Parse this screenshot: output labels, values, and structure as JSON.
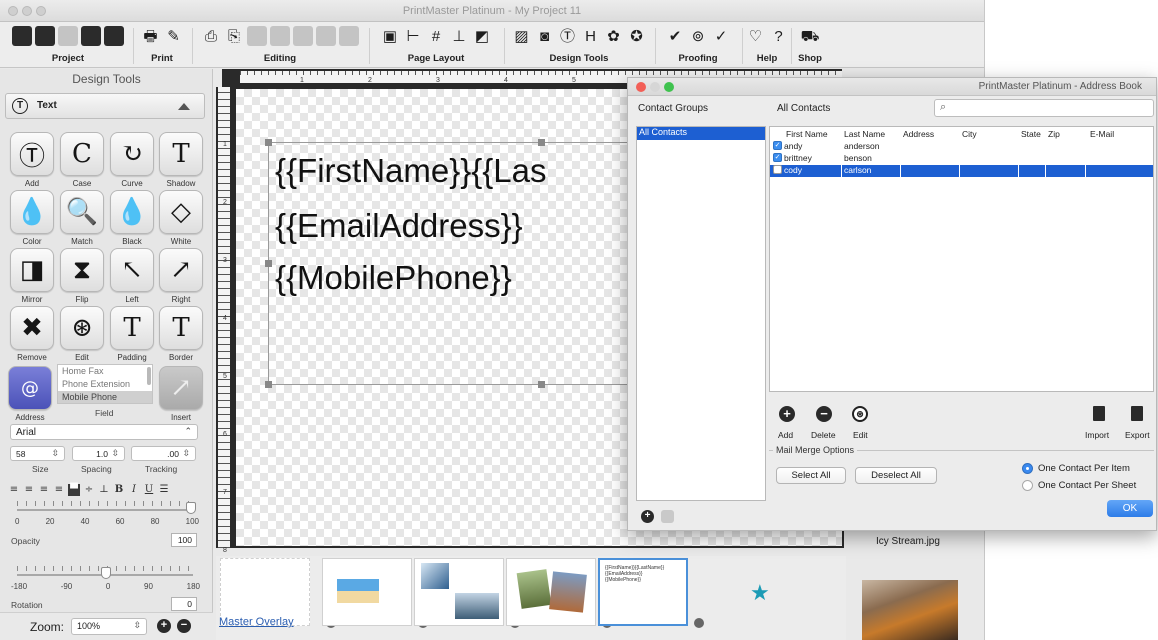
{
  "main_window": {
    "title": "PrintMaster Platinum - My Project 11",
    "toolbar": [
      {
        "label": "Project"
      },
      {
        "label": "Print"
      },
      {
        "label": "Editing"
      },
      {
        "label": "Page Layout"
      },
      {
        "label": "Design Tools"
      },
      {
        "label": "Proofing"
      },
      {
        "label": "Help"
      },
      {
        "label": "Shop"
      }
    ]
  },
  "design_tools": {
    "title": "Design Tools",
    "section": "Text",
    "tools": [
      {
        "label": "Add",
        "glyph": "Ⓣ"
      },
      {
        "label": "Case",
        "glyph": "C"
      },
      {
        "label": "Curve",
        "glyph": "↻"
      },
      {
        "label": "Shadow",
        "glyph": "T"
      },
      {
        "label": "Color",
        "glyph": "💧"
      },
      {
        "label": "Match",
        "glyph": "🔍"
      },
      {
        "label": "Black",
        "glyph": "💧"
      },
      {
        "label": "White",
        "glyph": "◇"
      },
      {
        "label": "Mirror",
        "glyph": "◨"
      },
      {
        "label": "Flip",
        "glyph": "⧗"
      },
      {
        "label": "Left",
        "glyph": "↖"
      },
      {
        "label": "Right",
        "glyph": "↗"
      },
      {
        "label": "Remove",
        "glyph": "✖"
      },
      {
        "label": "Edit",
        "glyph": "⊛"
      },
      {
        "label": "Padding",
        "glyph": "T"
      },
      {
        "label": "Border",
        "glyph": "T"
      }
    ],
    "field_list": [
      "Home Fax",
      "Phone Extension",
      "Mobile Phone"
    ],
    "address_label": "Address",
    "field_label": "Field",
    "insert_label": "Insert",
    "font": "Arial",
    "size": "58",
    "spacing": "1.0",
    "tracking": ".00",
    "size_label": "Size",
    "spacing_label": "Spacing",
    "tracking_label": "Tracking",
    "opacity_ticks": [
      "0",
      "20",
      "40",
      "60",
      "80",
      "100"
    ],
    "opacity_label": "Opacity",
    "opacity_value": "100",
    "rotation_ticks": [
      "-180",
      "-90",
      "0",
      "90",
      "180"
    ],
    "rotation_label": "Rotation",
    "rotation_value": "0",
    "zoom_label": "Zoom:",
    "zoom_value": "100%"
  },
  "canvas": {
    "lines": [
      "{{FirstName}}{{Las",
      "{{EmailAddress}}",
      "{{MobilePhone}}"
    ],
    "ruler_top": [
      "1",
      "2",
      "3",
      "4",
      "5",
      "6",
      "7"
    ],
    "ruler_left": [
      "1",
      "2",
      "3",
      "4",
      "5",
      "6",
      "7",
      "8"
    ]
  },
  "thumbnails": {
    "master_overlay": "Master Overlay",
    "preview_text": "{{FirstName}}{{LastName}} {{EmailAddress}} {{MobilePhone}}"
  },
  "side_panel": {
    "image_caption": "Icy Stream.jpg"
  },
  "address_book": {
    "title": "PrintMaster Platinum - Address Book",
    "groups_header": "Contact Groups",
    "contacts_header": "All Contacts",
    "groups": [
      "All Contacts"
    ],
    "columns": [
      "First Name",
      "Last Name",
      "Address",
      "City",
      "State",
      "Zip",
      "E-Mail"
    ],
    "rows": [
      {
        "first": "andy",
        "last": "anderson",
        "checked": true
      },
      {
        "first": "brittney",
        "last": "benson",
        "checked": true
      },
      {
        "first": "cody",
        "last": "carlson",
        "checked": false
      }
    ],
    "actions": {
      "add": "Add",
      "delete": "Delete",
      "edit": "Edit",
      "import": "Import",
      "export": "Export"
    },
    "merge_legend": "Mail Merge Options",
    "select_all": "Select All",
    "deselect_all": "Deselect All",
    "one_per_item": "One Contact Per Item",
    "one_per_sheet": "One Contact Per Sheet",
    "ok": "OK"
  },
  "colors": {
    "accent": "#1d5fd2",
    "ok_button": "#2d7ce8"
  }
}
